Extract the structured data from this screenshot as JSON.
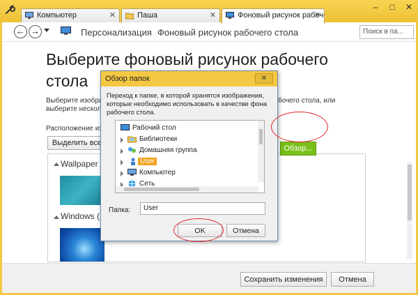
{
  "window": {
    "tabs": [
      {
        "label": "Компьютер"
      },
      {
        "label": "Паша"
      },
      {
        "label": "Фоновый рисунок рабоче"
      }
    ],
    "controls": {
      "minimize": "–",
      "maximize": "□",
      "close": "✕"
    }
  },
  "nav": {
    "back": "←",
    "forward": "→",
    "breadcrumbs": [
      {
        "label": "Персонализация"
      },
      {
        "label": "Фоновый рисунок рабочего стола"
      }
    ],
    "search_placeholder": "Поиск в па..."
  },
  "main": {
    "title": "Выберите фоновый рисунок рабочего стола",
    "desc_left_1": "Выберите изображ",
    "desc_left_2": "выберите нескольк",
    "desc_right_1": "бочего стола, или",
    "desc_right_2": "",
    "location_label": "Расположение изобр",
    "select_all": "Выделить все",
    "groups": [
      {
        "title": "Wallpaper (2"
      },
      {
        "title": "Windows (1)"
      }
    ],
    "browse_button": "Обзор..."
  },
  "footer": {
    "save": "Сохранить изменения",
    "cancel": "Отмена"
  },
  "dialog": {
    "title": "Обзор папок",
    "close": "✕",
    "description": "Переход к папке, в которой хранятся изображения, которые необходимо использовать в качестве фона рабочего стола.",
    "tree": [
      {
        "label": "Рабочий стол",
        "icon": "desktop-icon",
        "expander": false
      },
      {
        "label": "Библиотеки",
        "icon": "libraries-icon",
        "expander": true
      },
      {
        "label": "Домашняя группа",
        "icon": "homegroup-icon",
        "expander": true
      },
      {
        "label": "User",
        "icon": "user-folder-icon",
        "expander": true,
        "selected": true
      },
      {
        "label": "Компьютер",
        "icon": "computer-icon",
        "expander": true
      },
      {
        "label": "Сеть",
        "icon": "network-icon",
        "expander": true
      }
    ],
    "folder_label": "Папка:",
    "folder_value": "User",
    "ok": "OK",
    "cancel": "Отмена"
  },
  "colors": {
    "titlebar": "#f4c842",
    "selection": "#f0a21e",
    "browse_green": "#7bbf1a",
    "annotation_red": "#e0252a"
  }
}
